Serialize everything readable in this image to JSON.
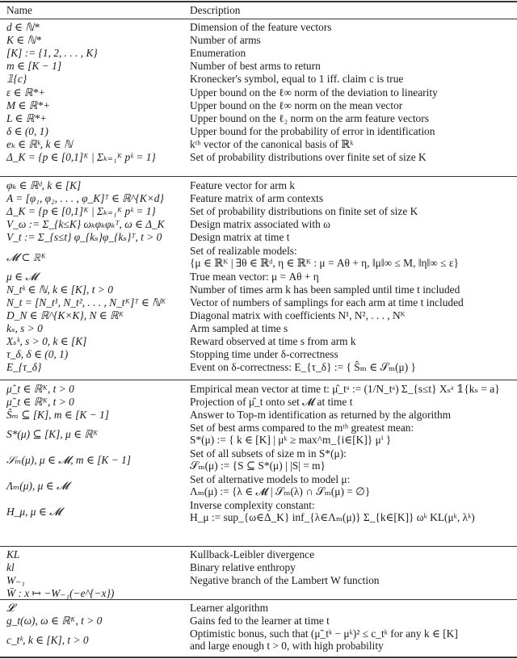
{
  "header": {
    "name": "Name",
    "description": "Description"
  },
  "sections": [
    {
      "rows": [
        {
          "name": "d ∈ ℕ*",
          "description": "Dimension of the feature vectors"
        },
        {
          "name": "K ∈ ℕ*",
          "description": "Number of arms"
        },
        {
          "name": "[K] := {1, 2, . . . , K}",
          "description": "Enumeration"
        },
        {
          "name": "m ∈ [K − 1]",
          "description": "Number of best arms to return"
        },
        {
          "name": "𝟙{c}",
          "description": "Kronecker's symbol, equal to 1 iff. claim c is true"
        },
        {
          "name": "ε ∈ ℝ*+",
          "description": "Upper bound on the ℓ∞ norm of the deviation to linearity"
        },
        {
          "name": "M ∈ ℝ*+",
          "description": "Upper bound on the ℓ∞ norm on the mean vector"
        },
        {
          "name": "L ∈ ℝ*+",
          "description": "Upper bound on the ℓ₂ norm on the arm feature vectors"
        },
        {
          "name": "δ ∈ (0, 1)",
          "description": "Upper bound for the probability of error in identification"
        },
        {
          "name": "eₖ ∈ ℝᵏ, k ∈ ℕ",
          "description": "kᵗʰ vector of the canonical basis of ℝᵏ"
        },
        {
          "name": "Δ_K = {p ∈ [0,1]ᴷ | Σₖ₌₁ᴷ pᵏ = 1}",
          "description": "Set of probability distributions over finite set of size K"
        }
      ]
    },
    {
      "rows": [
        {
          "name": "φₖ ∈ ℝᵈ, k ∈ [K]",
          "description": "Feature vector for arm k"
        },
        {
          "name": "A = [φ₁, φ₂, . . . , φ_K]ᵀ ∈ ℝ^{K×d}",
          "description": "Feature matrix of arm contexts"
        },
        {
          "name": "Δ_K = {p ∈ [0,1]ᴷ | Σₖ₌₁ᴷ pᵏ = 1}",
          "description": "Set of probability distributions on finite set of size K"
        },
        {
          "name": "V_ω := Σ_{k≤K} ωₖφₖφₖᵀ, ω ∈ Δ_K",
          "description": "Design matrix associated with ω"
        },
        {
          "name": "V_t := Σ_{s≤t} φ_{kₛ}φ_{kₛ}ᵀ, t > 0",
          "description": "Design matrix at time t"
        },
        {
          "name": "𝓜 ⊂ ℝᴷ",
          "description": "Set of realizable models:",
          "description_line2": "{μ ∈ ℝᴷ | ∃θ ∈ ℝᵈ, η ∈ ℝᴷ : μ = Aθ + η, ‖μ‖∞ ≤ M, ‖η‖∞ ≤ ε}"
        },
        {
          "name": "μ ∈ 𝓜",
          "description": "True mean vector: μ = Aθ + η"
        },
        {
          "name": "N_tᵏ ∈ ℕ, k ∈ [K], t > 0",
          "description": "Number of times arm k has been sampled until time t included"
        },
        {
          "name": "N_t = [N_t¹, N_t², . . . , N_tᴷ]ᵀ ∈ ℕᴷ",
          "description": "Vector of numbers of samplings for each arm at time t included"
        },
        {
          "name": "D_N ∈ ℝ^{K×K}, N ∈ ℝᴷ",
          "description": "Diagonal matrix with coefficients N¹, N², . . . , Nᴷ"
        },
        {
          "name": "kₛ, s > 0",
          "description": "Arm sampled at time s"
        },
        {
          "name": "Xₛᵏ, s > 0, k ∈ [K]",
          "description": "Reward observed at time s from arm k"
        },
        {
          "name": "τ_δ, δ ∈ (0, 1)",
          "description": "Stopping time under δ-correctness"
        },
        {
          "name": "E_{τ_δ}",
          "description": "Event on δ-correctness: E_{τ_δ} := { Ŝₘ ∈ 𝒮ₘ(μ) }"
        }
      ]
    },
    {
      "rows": [
        {
          "name": "μ̂_t ∈ ℝᴷ, t > 0",
          "description": "Empirical mean vector at time t: μ̂_tᵃ := (1/N_tᵃ) Σ_{s≤t} Xₛᵃ 𝟙{kₛ = a}"
        },
        {
          "name": "μ̃_t ∈ ℝᴷ, t > 0",
          "description": "Projection of μ̂_t onto set 𝓜 at time t"
        },
        {
          "name": "Ŝₘ ⊆ [K], m ∈ [K − 1]",
          "description": "Answer to Top-m identification as returned by the algorithm"
        },
        {
          "name": "S*(μ) ⊆ [K], μ ∈ ℝᴷ",
          "description": "Set of best arms compared to the mᵗʰ greatest mean:",
          "description_line2": "S*(μ) := { k ∈ [K] | μᵏ ≥ max^m_{i∈[K]} μⁱ }"
        },
        {
          "name": "𝒮ₘ(μ), μ ∈ 𝓜, m ∈ [K − 1]",
          "description": "Set of all subsets of size m in S*(μ):",
          "description_line2": "𝒮ₘ(μ) := {S ⊆ S*(μ) | |S| = m}"
        },
        {
          "name": "Λₘ(μ), μ ∈ 𝓜",
          "description": "Set of alternative models to model μ:",
          "description_line2": "Λₘ(μ) := {λ ∈ 𝓜 | 𝒮ₘ(λ) ∩ 𝒮ₘ(μ) = ∅}"
        },
        {
          "name": "H_μ, μ ∈ 𝓜",
          "description": "Inverse complexity constant:",
          "description_line2": "H_μ := sup_{ω∈Δ_K} inf_{λ∈Λₘ(μ)} Σ_{k∈[K]} ωᵏ KL(μᵏ, λᵏ)"
        }
      ]
    },
    {
      "rows": [
        {
          "name": "KL",
          "description": "Kullback-Leibler divergence"
        },
        {
          "name": "kl",
          "description": "Binary relative enthropy"
        },
        {
          "name": "W₋₁",
          "description": "Negative branch of the Lambert W function"
        },
        {
          "name": "W̄ : x ↦ −W₋₁(−e^{−x})",
          "description": ""
        }
      ]
    },
    {
      "rows": [
        {
          "name": "𝓛",
          "description": "Learner algorithm"
        },
        {
          "name": "g_t(ω), ω ∈ ℝᴷ, t > 0",
          "description": "Gains fed to the learner at time t"
        },
        {
          "name": "c_tᵏ, k ∈ [K], t > 0",
          "description": "Optimistic bonus, such that (μ̃_tᵏ − μᵏ)² ≤ c_tᵏ for any k ∈ [K]",
          "description_line2": "and large enough t > 0, with high probability"
        }
      ]
    }
  ]
}
